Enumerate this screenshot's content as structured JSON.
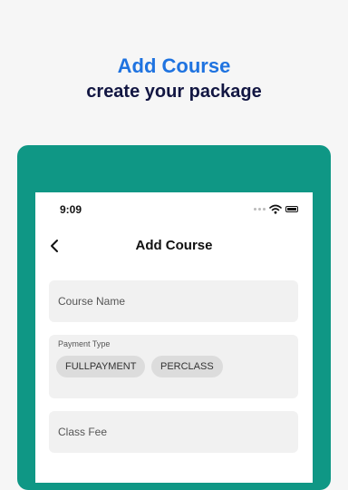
{
  "promo": {
    "title": "Add Course",
    "subtitle": "create your package"
  },
  "status_bar": {
    "time": "9:09"
  },
  "header": {
    "title": "Add Course"
  },
  "form": {
    "course_name_placeholder": "Course Name",
    "payment_type_label": "Payment Type",
    "payment_options": [
      "FULLPAYMENT",
      "PERCLASS"
    ],
    "class_fee_placeholder": "Class Fee"
  },
  "colors": {
    "accent": "#1f73e0",
    "frame": "#0f9785",
    "subtitle": "#121642"
  }
}
